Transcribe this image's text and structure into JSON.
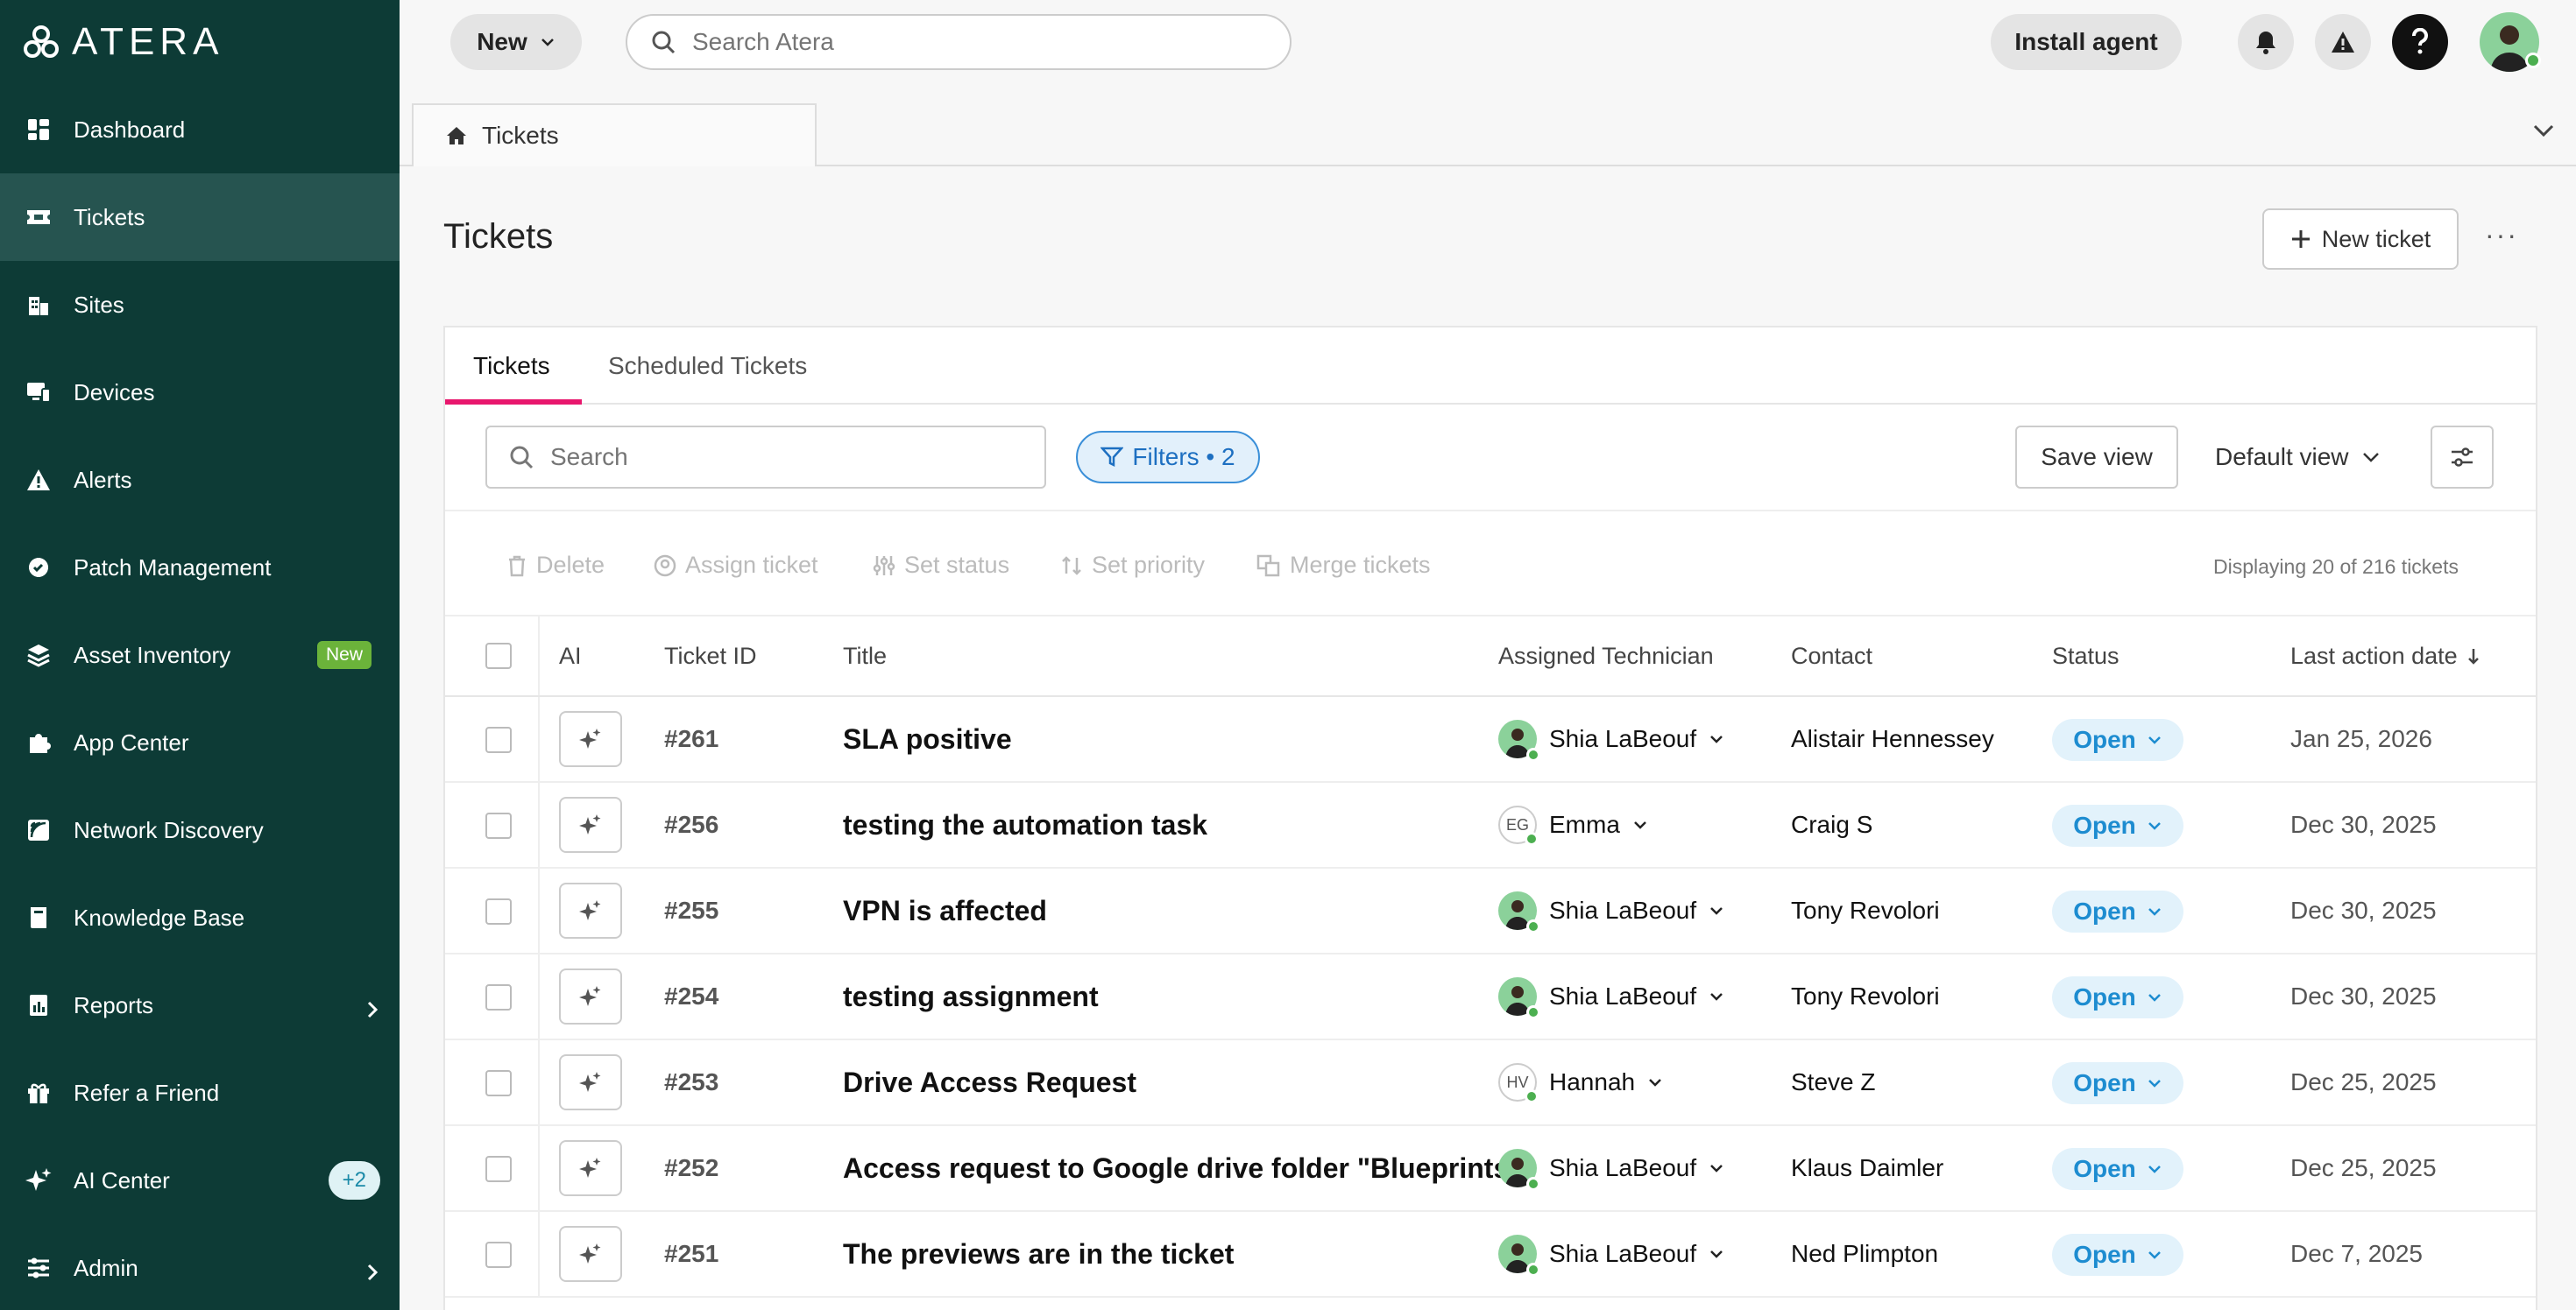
{
  "app": {
    "logo_text": "ATERA"
  },
  "sidebar": {
    "items": [
      {
        "label": "Dashboard",
        "icon": "dashboard-icon"
      },
      {
        "label": "Tickets",
        "icon": "ticket-icon",
        "active": true
      },
      {
        "label": "Sites",
        "icon": "building-icon"
      },
      {
        "label": "Devices",
        "icon": "devices-icon"
      },
      {
        "label": "Alerts",
        "icon": "alert-icon"
      },
      {
        "label": "Patch Management",
        "icon": "patch-icon"
      },
      {
        "label": "Asset Inventory",
        "icon": "layers-icon",
        "badge": "New"
      },
      {
        "label": "App Center",
        "icon": "puzzle-icon"
      },
      {
        "label": "Network Discovery",
        "icon": "network-icon"
      },
      {
        "label": "Knowledge Base",
        "icon": "book-icon"
      },
      {
        "label": "Reports",
        "icon": "reports-icon",
        "chevron": true
      },
      {
        "label": "Refer a Friend",
        "icon": "gift-icon"
      },
      {
        "label": "AI Center",
        "icon": "sparkle-icon",
        "badge": "+2"
      },
      {
        "label": "Admin",
        "icon": "sliders-icon",
        "chevron": true
      }
    ]
  },
  "topbar": {
    "new_label": "New",
    "search_placeholder": "Search Atera",
    "install_label": "Install agent"
  },
  "breadcrumb": {
    "tab_label": "Tickets"
  },
  "page": {
    "title": "Tickets",
    "new_ticket_label": "New ticket",
    "more": "···"
  },
  "card": {
    "tabs": [
      "Tickets",
      "Scheduled Tickets"
    ],
    "search_placeholder": "Search",
    "filters_label": "Filters • 2",
    "save_view_label": "Save view",
    "default_view_label": "Default view",
    "actions": [
      "Delete",
      "Assign ticket",
      "Set status",
      "Set priority",
      "Merge tickets"
    ],
    "displaying": "Displaying 20 of 216 tickets"
  },
  "table": {
    "headers": {
      "ai": "AI",
      "id": "Ticket ID",
      "title": "Title",
      "tech": "Assigned Technician",
      "contact": "Contact",
      "status": "Status",
      "date": "Last action date"
    },
    "rows": [
      {
        "id": "#261",
        "title": "SLA positive",
        "tech": "Shia LaBeouf",
        "tech_initials": "",
        "contact": "Alistair Hennessey",
        "status": "Open",
        "date": "Jan 25, 2026"
      },
      {
        "id": "#256",
        "title": "testing the automation task",
        "tech": "Emma",
        "tech_initials": "EG",
        "contact": "Craig S",
        "status": "Open",
        "date": "Dec 30, 2025"
      },
      {
        "id": "#255",
        "title": "VPN is affected",
        "tech": "Shia LaBeouf",
        "tech_initials": "",
        "contact": "Tony Revolori",
        "status": "Open",
        "date": "Dec 30, 2025"
      },
      {
        "id": "#254",
        "title": "testing assignment",
        "tech": "Shia LaBeouf",
        "tech_initials": "",
        "contact": "Tony Revolori",
        "status": "Open",
        "date": "Dec 30, 2025"
      },
      {
        "id": "#253",
        "title": "Drive Access Request",
        "tech": "Hannah",
        "tech_initials": "HV",
        "contact": "Steve Z",
        "status": "Open",
        "date": "Dec 25, 2025"
      },
      {
        "id": "#252",
        "title": "Access request to Google drive folder \"Blueprints\"",
        "tech": "Shia LaBeouf",
        "tech_initials": "",
        "contact": "Klaus Daimler",
        "status": "Open",
        "date": "Dec 25, 2025"
      },
      {
        "id": "#251",
        "title": "The previews are in the ticket",
        "tech": "Shia LaBeouf",
        "tech_initials": "",
        "contact": "Ned Plimpton",
        "status": "Open",
        "date": "Dec 7, 2025"
      }
    ]
  },
  "colors": {
    "sidebar_bg": "#0d3b36",
    "accent_pink": "#e8176d",
    "status_blue": "#1d8cd0"
  }
}
